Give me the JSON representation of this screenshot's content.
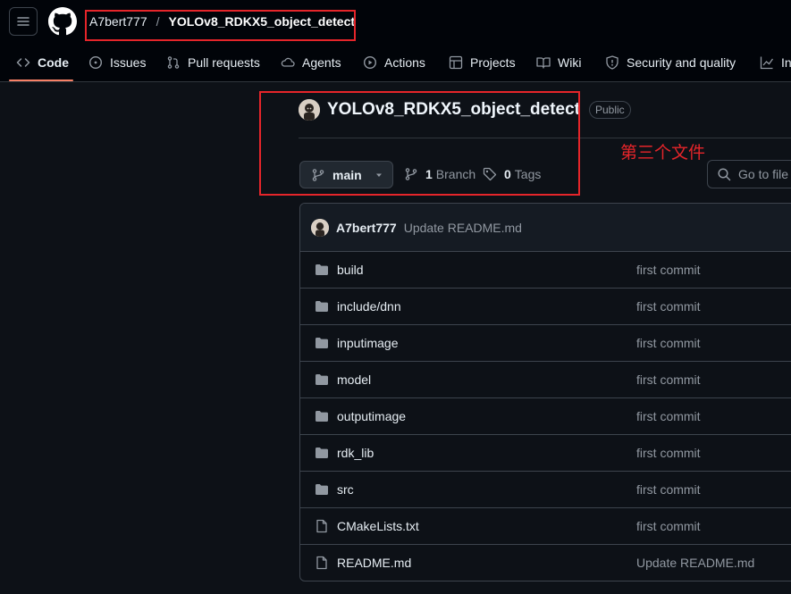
{
  "header": {
    "owner": "A7bert777",
    "separator": "/",
    "repo": "YOLOv8_RDKX5_object_detect"
  },
  "nav_tabs": [
    {
      "label": "Code",
      "icon": "code-icon",
      "active": true
    },
    {
      "label": "Issues",
      "icon": "issue-opened-icon"
    },
    {
      "label": "Pull requests",
      "icon": "git-pull-request-icon"
    },
    {
      "label": "Agents",
      "icon": "agent-icon"
    },
    {
      "label": "Actions",
      "icon": "play-icon"
    },
    {
      "label": "Projects",
      "icon": "table-icon"
    },
    {
      "label": "Wiki",
      "icon": "book-icon"
    },
    {
      "label": "Security and quality",
      "icon": "shield-icon"
    },
    {
      "label": "In",
      "icon": "graph-icon"
    }
  ],
  "repo_header": {
    "name": "YOLOv8_RDKX5_object_detect",
    "visibility": "Public"
  },
  "annotation": "第三个文件",
  "branch": {
    "current": "main",
    "branch_count": "1",
    "branch_label": "Branch",
    "tag_count": "0",
    "tag_label": "Tags"
  },
  "goto_file": "Go to file",
  "latest_commit": {
    "author": "A7bert777",
    "message": "Update README.md"
  },
  "files": [
    {
      "name": "build",
      "type": "folder",
      "message": "first commit"
    },
    {
      "name": "include/dnn",
      "type": "folder",
      "message": "first commit"
    },
    {
      "name": "inputimage",
      "type": "folder",
      "message": "first commit"
    },
    {
      "name": "model",
      "type": "folder",
      "message": "first commit"
    },
    {
      "name": "outputimage",
      "type": "folder",
      "message": "first commit"
    },
    {
      "name": "rdk_lib",
      "type": "folder",
      "message": "first commit"
    },
    {
      "name": "src",
      "type": "folder",
      "message": "first commit"
    },
    {
      "name": "CMakeLists.txt",
      "type": "file",
      "message": "first commit"
    },
    {
      "name": "README.md",
      "type": "file",
      "message": "Update README.md"
    }
  ],
  "colors": {
    "background": "#0d1117",
    "header": "#010409",
    "border": "#3d444d",
    "accent_underline": "#f78166",
    "annotation_red": "#e5252a"
  }
}
